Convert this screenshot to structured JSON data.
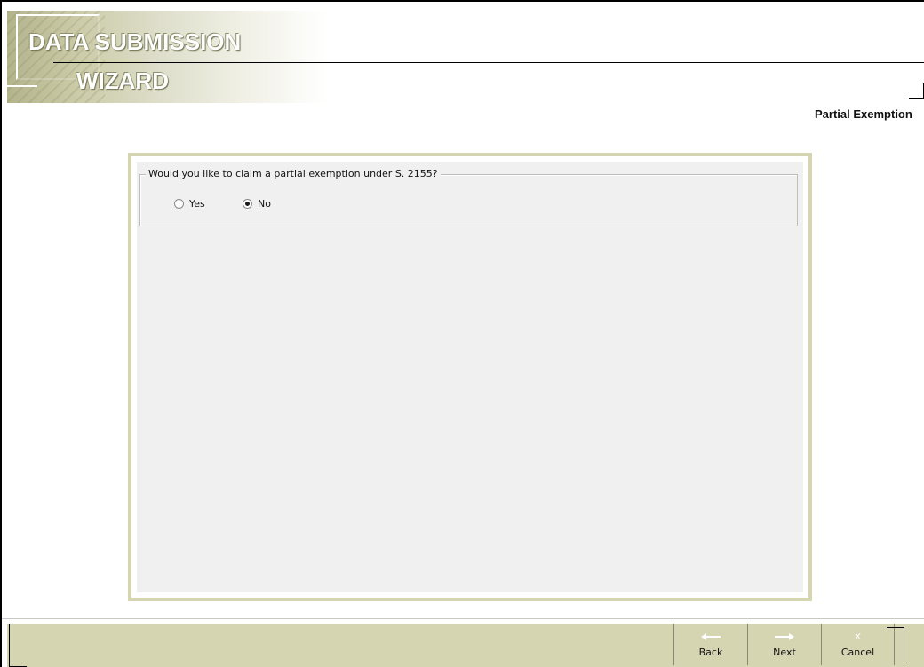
{
  "header": {
    "logo_line1": "DATA SUBMISSION",
    "logo_line2": "WIZARD",
    "page_subtitle": "Partial Exemption"
  },
  "question_group": {
    "legend": "Would you like to claim a partial exemption under S. 2155?",
    "options": [
      {
        "label": "Yes",
        "checked": false
      },
      {
        "label": "No",
        "checked": true
      }
    ]
  },
  "nav": {
    "back_label": "Back",
    "next_label": "Next",
    "cancel_label": "Cancel",
    "cancel_glyph": "X",
    "back_icon": "arrow-left-icon",
    "next_icon": "arrow-right-icon"
  },
  "colors": {
    "accent": "#d5d5b2",
    "panel_bg": "#f0f0f0"
  }
}
